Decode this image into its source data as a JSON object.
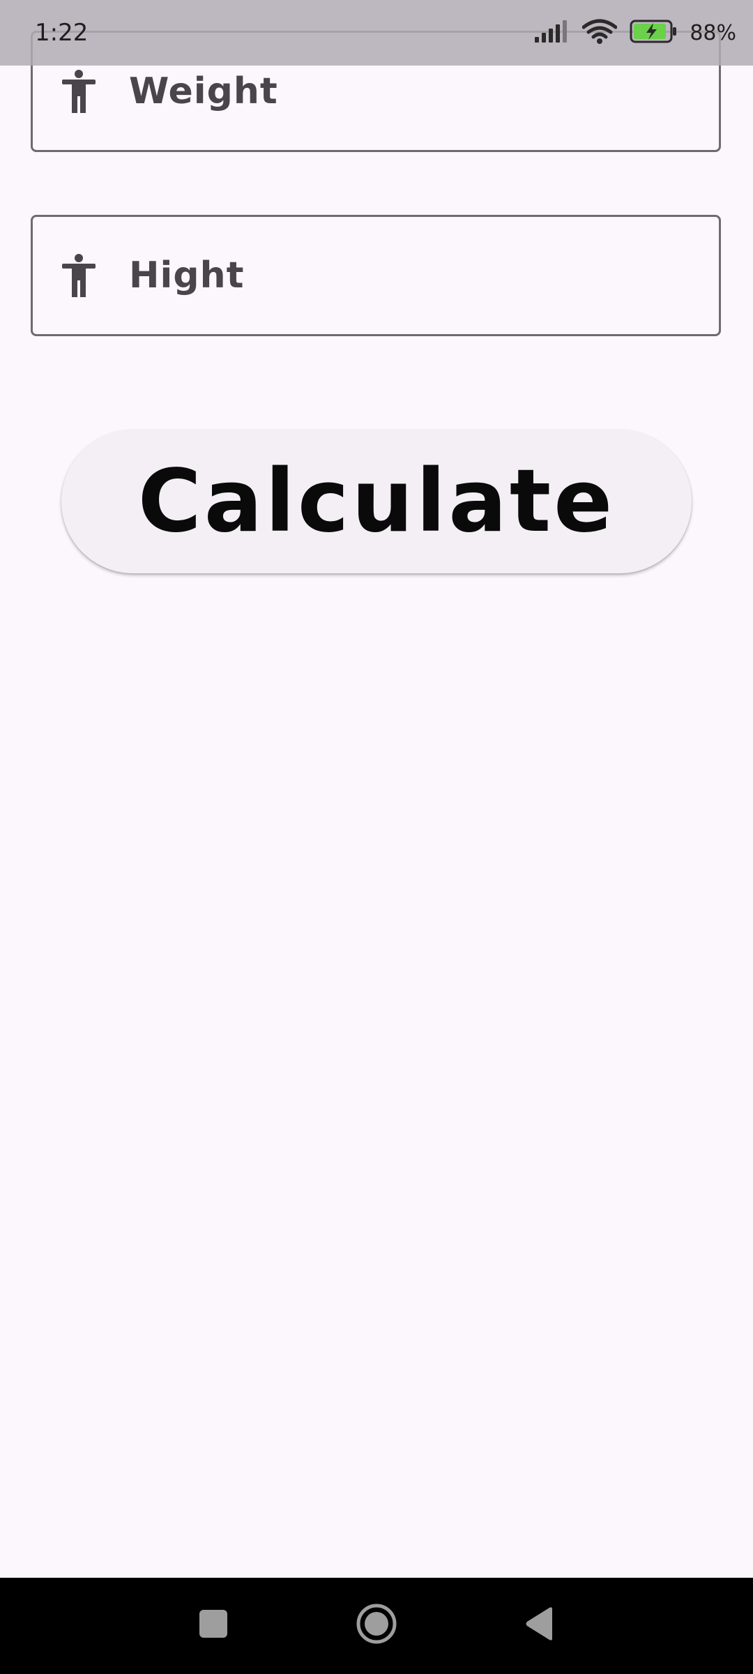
{
  "status_bar": {
    "time": "1:22",
    "battery_percent": "88%",
    "signal_icon": "cellular-signal-icon",
    "wifi_icon": "wifi-icon",
    "battery_icon": "battery-charging-icon"
  },
  "form": {
    "weight_field": {
      "placeholder": "Weight",
      "icon": "accessibility-person-icon"
    },
    "height_field": {
      "placeholder": "Hight",
      "icon": "accessibility-person-icon"
    },
    "calculate_button": {
      "label": "Calculate"
    }
  },
  "nav_bar": {
    "recents_icon": "recents-square-icon",
    "home_icon": "home-circle-icon",
    "back_icon": "back-triangle-icon"
  },
  "colors": {
    "background": "#fcf7fc",
    "outline": "#6f6a70",
    "label_text": "#4a454c",
    "button_bg": "#f4eff5",
    "battery_fill": "#6bd04a"
  }
}
